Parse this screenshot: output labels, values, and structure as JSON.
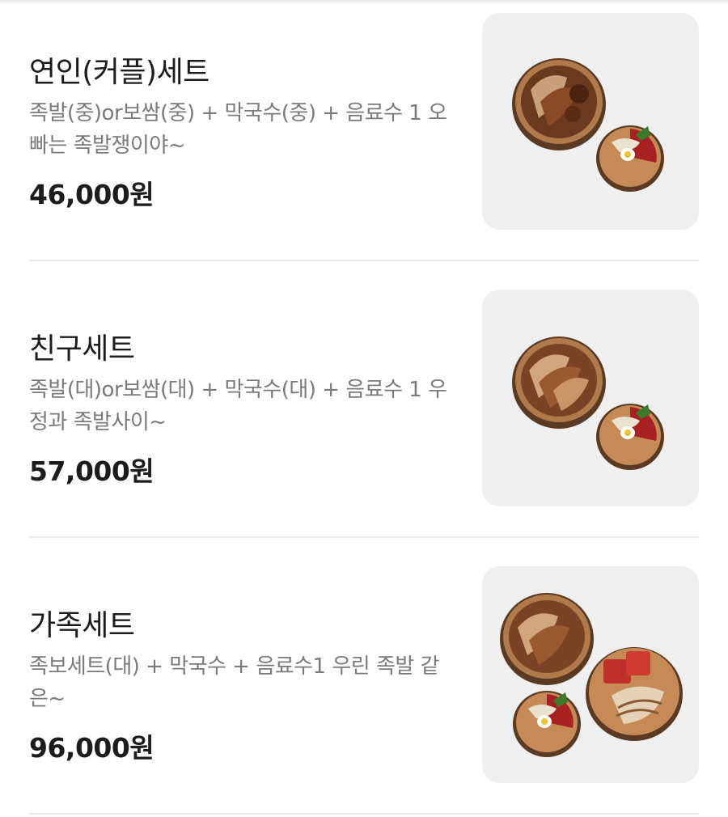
{
  "menu": {
    "items": [
      {
        "name": "연인(커플)세트",
        "description": "족발(중)or보쌈(중) + 막국수(중) + 음료수 1 오빠는 족발쟁이야~",
        "price": "46,000원",
        "image_icon": "jokbal-set-food-image"
      },
      {
        "name": "친구세트",
        "description": "족발(대)or보쌈(대) + 막국수(대) + 음료수 1 우정과 족발사이~",
        "price": "57,000원",
        "image_icon": "jokbal-set-food-image"
      },
      {
        "name": "가족세트",
        "description": "족보세트(대) + 막국수 + 음료수1 우린 족발 같은~",
        "price": "96,000원",
        "image_icon": "jokbo-family-set-food-image"
      }
    ]
  },
  "colors": {
    "background": "#ffffff",
    "name_text": "#1c1c1c",
    "description_text": "#7a7a7a",
    "thumbnail_bg": "#efefef",
    "divider": "#ececec"
  }
}
